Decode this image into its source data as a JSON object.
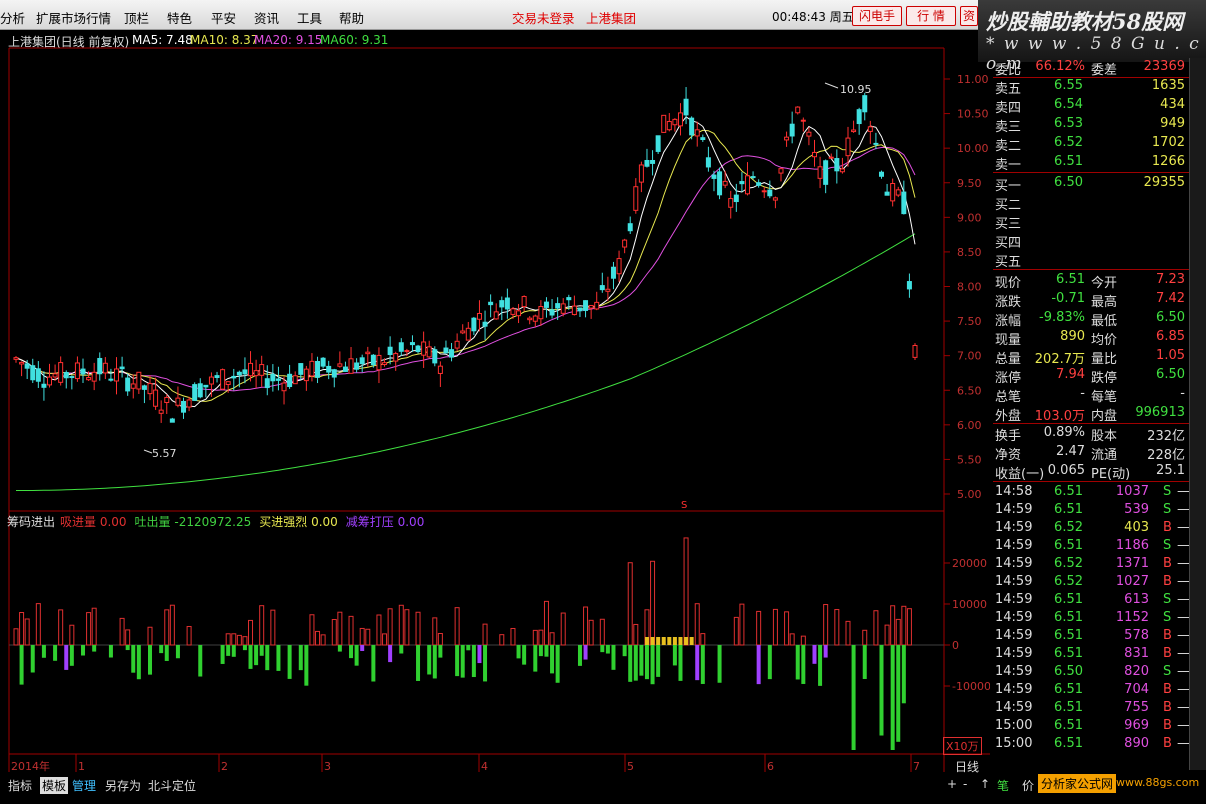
{
  "menu": {
    "items": [
      "分析",
      "扩展市场行情",
      "顶栏",
      "特色",
      "平安",
      "资讯",
      "工具",
      "帮助"
    ],
    "trade_status": "交易未登录",
    "stock_title": "上港集团",
    "clock": "00:48:43",
    "weekday": "周五",
    "btn_flash": "闪电手",
    "btn_quote": "行 情",
    "btn_trade": "资"
  },
  "logo": {
    "line1": "炒股輔助教材58股网",
    "line2": "* w w w . 5 8 G u . c o m"
  },
  "chart": {
    "header": "上港集团(日线 前复权)",
    "ma5": "MA5: 7.48",
    "ma10": "MA10: 8.37",
    "ma20": "MA20: 9.15",
    "ma60": "MA60: 9.31",
    "hi_label": "10.95",
    "lo_label": "5.57",
    "y_ticks": [
      "11.00",
      "10.50",
      "10.00",
      "9.50",
      "9.00",
      "8.50",
      "8.00",
      "7.50",
      "7.00",
      "6.50",
      "6.00",
      "5.50",
      "5.00"
    ],
    "ind_name": "筹码进出",
    "ind_items": [
      {
        "k": "吸进量",
        "v": "0.00",
        "c": "#e03030"
      },
      {
        "k": "吐出量",
        "v": "-2120972.25",
        "c": "#40d040"
      },
      {
        "k": "买进强烈",
        "v": "0.00",
        "c": "#e8e850"
      },
      {
        "k": "减筹打压",
        "v": "0.00",
        "c": "#a040ff"
      }
    ],
    "ind_ticks": [
      "20000",
      "10000",
      "0",
      "-10000"
    ],
    "unit": "X10万",
    "x_ticks": [
      "2014年",
      "1",
      "2",
      "3",
      "4",
      "5",
      "6",
      "7"
    ],
    "period": "日线",
    "marker": "S"
  },
  "quote": {
    "weibi": {
      "k": "委比",
      "v": "66.12%",
      "k2": "委差",
      "v2": "23369"
    },
    "sell": [
      {
        "k": "卖五",
        "p": "6.55",
        "v": "1635"
      },
      {
        "k": "卖四",
        "p": "6.54",
        "v": "434"
      },
      {
        "k": "卖三",
        "p": "6.53",
        "v": "949"
      },
      {
        "k": "卖二",
        "p": "6.52",
        "v": "1702"
      },
      {
        "k": "卖一",
        "p": "6.51",
        "v": "1266"
      }
    ],
    "buy": [
      {
        "k": "买一",
        "p": "6.50",
        "v": "29355"
      },
      {
        "k": "买二",
        "p": "",
        "v": ""
      },
      {
        "k": "买三",
        "p": "",
        "v": ""
      },
      {
        "k": "买四",
        "p": "",
        "v": ""
      },
      {
        "k": "买五",
        "p": "",
        "v": ""
      }
    ],
    "stats": [
      {
        "k": "现价",
        "v": "6.51",
        "c": "#40e040",
        "k2": "今开",
        "v2": "7.23",
        "c2": "#ff4040"
      },
      {
        "k": "涨跌",
        "v": "-0.71",
        "c": "#40e040",
        "k2": "最高",
        "v2": "7.42",
        "c2": "#ff4040"
      },
      {
        "k": "涨幅",
        "v": "-9.83%",
        "c": "#40e040",
        "k2": "最低",
        "v2": "6.50",
        "c2": "#40e040"
      },
      {
        "k": "现量",
        "v": "890",
        "c": "#e8e850",
        "k2": "均价",
        "v2": "6.85",
        "c2": "#ff4040"
      },
      {
        "k": "总量",
        "v": "202.7万",
        "c": "#e8e850",
        "k2": "量比",
        "v2": "1.05",
        "c2": "#ff4040"
      },
      {
        "k": "涨停",
        "v": "7.94",
        "c": "#ff4040",
        "k2": "跌停",
        "v2": "6.50",
        "c2": "#40e040"
      },
      {
        "k": "总笔",
        "v": "-",
        "c": "#ddd",
        "k2": "每笔",
        "v2": "-",
        "c2": "#ddd"
      },
      {
        "k": "外盘",
        "v": "103.0万",
        "c": "#ff4040",
        "k2": "内盘",
        "v2": "996913",
        "c2": "#40e040"
      },
      {
        "k": "换手",
        "v": "0.89%",
        "c": "#ddd",
        "k2": "股本",
        "v2": "232亿",
        "c2": "#ddd"
      },
      {
        "k": "净资",
        "v": "2.47",
        "c": "#ddd",
        "k2": "流通",
        "v2": "228亿",
        "c2": "#ddd"
      },
      {
        "k": "收益(一)",
        "v": "0.065",
        "c": "#ddd",
        "k2": "PE(动)",
        "v2": "25.1",
        "c2": "#ddd"
      }
    ],
    "ticks": [
      {
        "t": "14:58",
        "p": "6.51",
        "v": "1037",
        "s": "S",
        "pc": "#40e040",
        "vc": "#e050e0",
        "sc": "#40e040"
      },
      {
        "t": "14:59",
        "p": "6.51",
        "v": "539",
        "s": "S",
        "pc": "#40e040",
        "vc": "#e050e0",
        "sc": "#40e040"
      },
      {
        "t": "14:59",
        "p": "6.52",
        "v": "403",
        "s": "B",
        "pc": "#40e040",
        "vc": "#e8e850",
        "sc": "#ff4040"
      },
      {
        "t": "14:59",
        "p": "6.51",
        "v": "1186",
        "s": "S",
        "pc": "#40e040",
        "vc": "#e050e0",
        "sc": "#40e040"
      },
      {
        "t": "14:59",
        "p": "6.52",
        "v": "1371",
        "s": "B",
        "pc": "#40e040",
        "vc": "#e050e0",
        "sc": "#ff4040"
      },
      {
        "t": "14:59",
        "p": "6.52",
        "v": "1027",
        "s": "B",
        "pc": "#40e040",
        "vc": "#e050e0",
        "sc": "#ff4040"
      },
      {
        "t": "14:59",
        "p": "6.51",
        "v": "613",
        "s": "S",
        "pc": "#40e040",
        "vc": "#e050e0",
        "sc": "#40e040"
      },
      {
        "t": "14:59",
        "p": "6.51",
        "v": "1152",
        "s": "S",
        "pc": "#40e040",
        "vc": "#e050e0",
        "sc": "#40e040"
      },
      {
        "t": "14:59",
        "p": "6.51",
        "v": "578",
        "s": "B",
        "pc": "#40e040",
        "vc": "#e050e0",
        "sc": "#ff4040"
      },
      {
        "t": "14:59",
        "p": "6.51",
        "v": "831",
        "s": "B",
        "pc": "#40e040",
        "vc": "#e050e0",
        "sc": "#ff4040"
      },
      {
        "t": "14:59",
        "p": "6.50",
        "v": "820",
        "s": "S",
        "pc": "#40e040",
        "vc": "#e050e0",
        "sc": "#40e040"
      },
      {
        "t": "14:59",
        "p": "6.51",
        "v": "704",
        "s": "B",
        "pc": "#40e040",
        "vc": "#e050e0",
        "sc": "#ff4040"
      },
      {
        "t": "14:59",
        "p": "6.51",
        "v": "755",
        "s": "B",
        "pc": "#40e040",
        "vc": "#e050e0",
        "sc": "#ff4040"
      },
      {
        "t": "15:00",
        "p": "6.51",
        "v": "969",
        "s": "B",
        "pc": "#40e040",
        "vc": "#e050e0",
        "sc": "#ff4040"
      },
      {
        "t": "15:00",
        "p": "6.51",
        "v": "890",
        "s": "B",
        "pc": "#40e040",
        "vc": "#e050e0",
        "sc": "#ff4040"
      }
    ]
  },
  "status": {
    "tabs": [
      "指标",
      "模板",
      "管理",
      "另存为",
      "北斗定位"
    ],
    "icons": [
      "+",
      "-",
      "↑",
      "笔",
      "价"
    ],
    "brand": "分析家公式网",
    "url": "www.88gs.com"
  }
}
